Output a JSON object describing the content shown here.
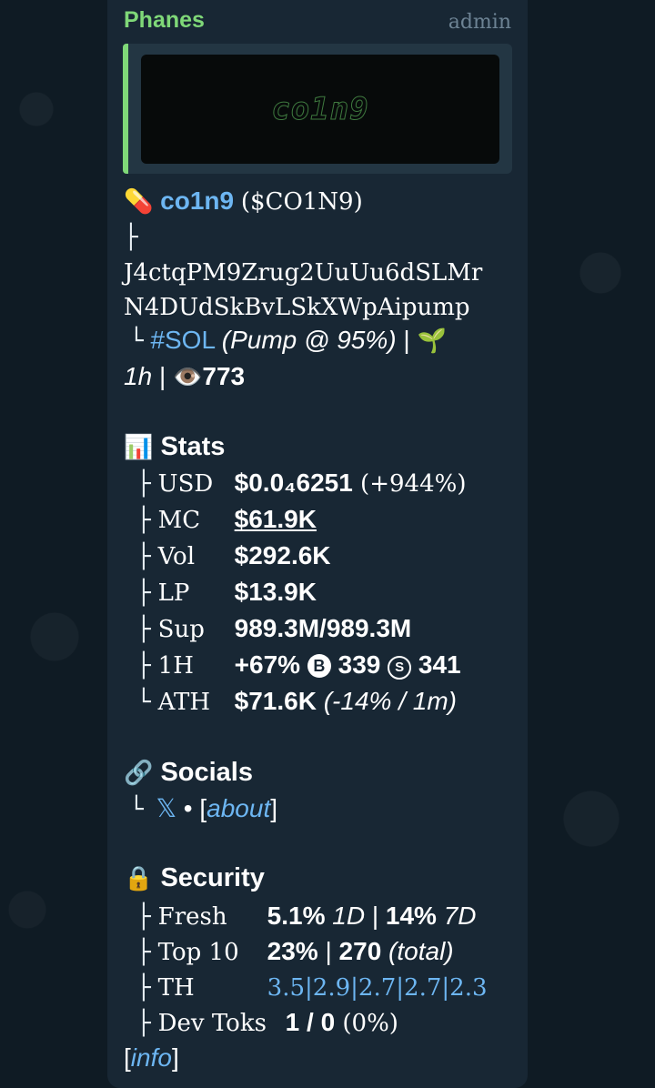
{
  "message": {
    "sender": "Phanes",
    "role": "admin",
    "preview_logo_text": "co1n9"
  },
  "token": {
    "name": "co1n9",
    "ticker": "($CO1N9)",
    "branch": "├",
    "address_line1": "J4ctqPM9Zrug2UuUu6dSLMr",
    "address_line2": "N4DUdSkBvLSkXWpAipump",
    "chain": "#SOL",
    "pump_info": "(Pump @ 95%)",
    "sep": "|",
    "age": "1h",
    "views": "773"
  },
  "stats": {
    "title": "Stats",
    "rows": [
      {
        "branch": "├",
        "label": "USD",
        "value": "$0.0₄6251",
        "extra": "(+944%)"
      },
      {
        "branch": "├",
        "label": "MC",
        "value": "$61.9K"
      },
      {
        "branch": "├",
        "label": "Vol",
        "value": "$292.6K"
      },
      {
        "branch": "├",
        "label": "LP",
        "value": "$13.9K"
      },
      {
        "branch": "├",
        "label": "Sup",
        "value": "989.3M/989.3M"
      },
      {
        "branch": "├",
        "label": "1H",
        "value": "+67%",
        "buy_icon": "B",
        "buys": "339",
        "sell_icon": "S",
        "sells": "341"
      },
      {
        "branch": "└",
        "label": "ATH",
        "value": "$71.6K",
        "extra": "(-14% / 1m)"
      }
    ]
  },
  "socials": {
    "title": "Socials",
    "branch": "└",
    "x_link": "𝕏",
    "dot": "•",
    "about_open": "[",
    "about_link": "about",
    "about_close": "]"
  },
  "security": {
    "title": "Security",
    "rows": [
      {
        "branch": "├",
        "label": "Fresh",
        "v1": "5.1%",
        "p1": "1D",
        "sep": "|",
        "v2": "14%",
        "p2": "7D"
      },
      {
        "branch": "├",
        "label": "Top 10",
        "v1": "23%",
        "sep": "|",
        "v2": "270",
        "p2": "(total)"
      },
      {
        "branch": "├",
        "label": "TH",
        "holders": [
          "3.5",
          "2.9",
          "2.7",
          "2.7",
          "2.3"
        ]
      },
      {
        "branch": "├",
        "label": "Dev Toks",
        "v1": "1 / 0",
        "extra": "(0%)"
      }
    ]
  },
  "footer": {
    "info_open": "[",
    "info_link": "info",
    "info_close": "]"
  },
  "colors": {
    "link": "#6db6f2",
    "sender": "#7fd878",
    "bubble": "#182734"
  },
  "icons": {
    "pill": "pill-icon",
    "sprout": "sprout-icon",
    "eye": "eye-icon",
    "chart": "bar-chart-icon",
    "link": "link-icon",
    "lock": "lock-icon"
  }
}
